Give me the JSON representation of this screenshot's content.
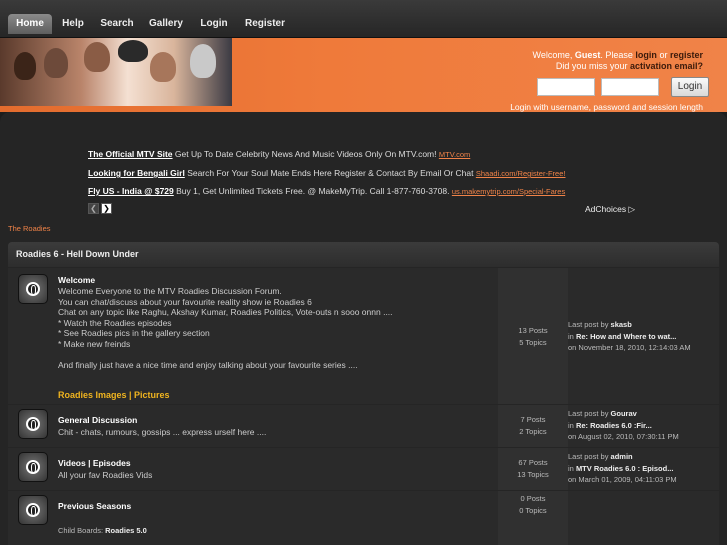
{
  "nav": {
    "items": [
      "Home",
      "Help",
      "Search",
      "Gallery",
      "Login",
      "Register"
    ]
  },
  "header": {
    "welcome_prefix": "Welcome,",
    "guest": "Guest",
    "please": ". Please",
    "login_link": "login",
    "or": "or",
    "register_link": "register",
    "miss_prefix": "Did you miss your",
    "activation_link": "activation email?",
    "login_button": "Login",
    "hint": "Login with username, password and session length"
  },
  "ads": [
    {
      "title": "The Official MTV Site",
      "text": "Get Up To Date Celebrity News And Music Videos Only On MTV.com!",
      "url": "MTV.com"
    },
    {
      "title": "Looking for Bengali Girl",
      "text": "Search For Your Soul Mate Ends Here Register & Contact By Email Or Chat",
      "url": "Shaadi.com/Register-Free!"
    },
    {
      "title": "Fly US - India @ $729",
      "text": "Buy 1, Get Unlimited Tickets Free. @ MakeMyTrip. Call 1-877-760-3708.",
      "url": "us.makemytrip.com/Special-Fares"
    }
  ],
  "adchoices": "AdChoices",
  "breadcrumb": "The Roadies",
  "category": "Roadies 6 - Hell Down Under",
  "boards": [
    {
      "title": "Welcome",
      "desc": "Welcome Everyone to the MTV Roadies Discussion Forum.\nYou can chat/discuss about your favourite reality show ie Roadies 6\nChat on any topic like Raghu, Akshay Kumar, Roadies Politics, Vote-outs n sooo onnn ....\n* Watch the Roadies episodes\n* See Roadies pics in the gallery section\n* Make new freinds\n\nAnd finally just have a nice time and enjoy talking about your favourite series ....",
      "sub": "Roadies Images | Pictures",
      "posts": "13 Posts",
      "topics": "5 Topics",
      "last_by": "skasb",
      "last_in": "Re: How and Where to wat...",
      "last_on": "on November 18, 2010, 12:14:03 AM"
    },
    {
      "title": "General Discussion",
      "desc": "Chit - chats, rumours, gossips ... express urself here ....",
      "posts": "7 Posts",
      "topics": "2 Topics",
      "last_by": "Gourav",
      "last_in": "Re: Roadies 6.0 :Fir...",
      "last_on": "on August 02, 2010, 07:30:11 PM"
    },
    {
      "title": "Videos | Episodes",
      "desc": "All your fav Roadies Vids",
      "posts": "67 Posts",
      "topics": "13 Topics",
      "last_by": "admin",
      "last_in": "MTV Roadies 6.0 : Episod...",
      "last_on": "on March 01, 2009, 04:11:03 PM"
    },
    {
      "title": "Previous Seasons",
      "desc": "",
      "posts": "0 Posts",
      "topics": "0 Topics",
      "child_label": "Child Boards:",
      "child": "Roadies 5.0"
    }
  ],
  "labels": {
    "last_post_by": "Last post by",
    "in": "in"
  }
}
